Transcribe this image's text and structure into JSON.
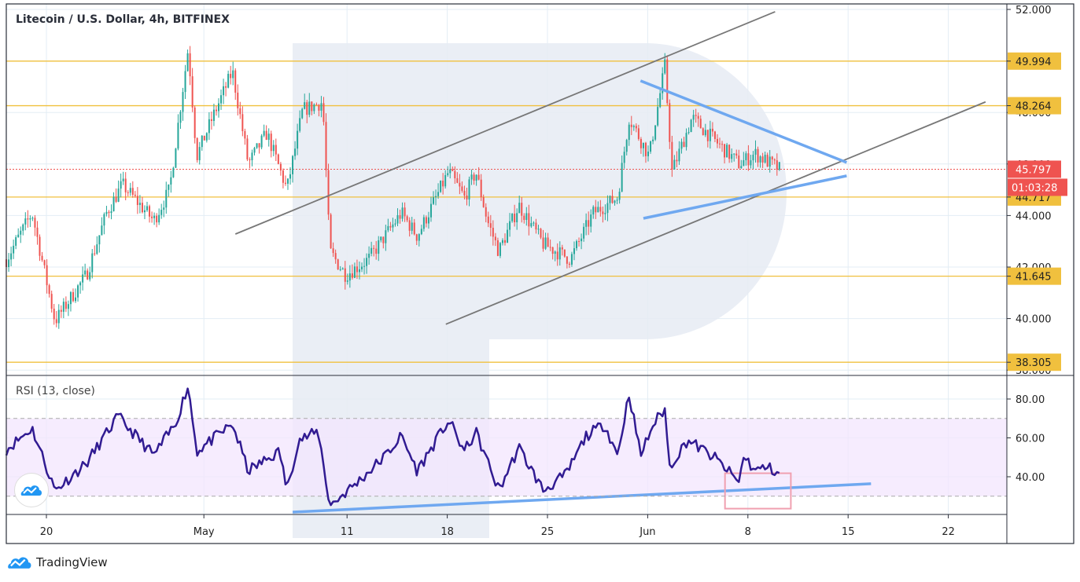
{
  "header": {
    "title": "Litecoin / U.S. Dollar, 4h, BITFINEX"
  },
  "rsi_title": "RSI (13, close)",
  "footer": {
    "brand": "TradingView"
  },
  "colors": {
    "up": "#26a69a",
    "down": "#ef5350",
    "level": "#f0c03e",
    "rsi": "#311b92",
    "trend": "#6fa8f0",
    "channel": "#777777",
    "band": "#f3e5fd",
    "highlight": "#f0a0b0"
  },
  "chart_data": [
    {
      "type": "candlestick",
      "title": "Litecoin / U.S. Dollar, 4h, BITFINEX",
      "x_unit": "days since Apr 20",
      "x_ticks": [
        {
          "day": 0,
          "label": "20"
        },
        {
          "day": 11,
          "label": "May"
        },
        {
          "day": 21,
          "label": "11"
        },
        {
          "day": 28,
          "label": "18"
        },
        {
          "day": 35,
          "label": "25"
        },
        {
          "day": 42,
          "label": "Jun"
        },
        {
          "day": 49,
          "label": "8"
        },
        {
          "day": 56,
          "label": "15"
        },
        {
          "day": 63,
          "label": "22"
        }
      ],
      "y_ticks": [
        "52.000",
        "50.000",
        "48.000",
        "46.000",
        "44.000",
        "42.000",
        "40.000",
        "38.000"
      ],
      "ylim": [
        37.8,
        52.2
      ],
      "close_path": [
        [
          -2.8,
          42.3
        ],
        [
          -1,
          44.1
        ],
        [
          0.6,
          39.9
        ],
        [
          2.8,
          41.7
        ],
        [
          4.2,
          44.1
        ],
        [
          5.3,
          45.2
        ],
        [
          7.5,
          43.8
        ],
        [
          8.6,
          45.0
        ],
        [
          9.9,
          50.5
        ],
        [
          10.5,
          46.3
        ],
        [
          11.6,
          47.8
        ],
        [
          13.0,
          49.6
        ],
        [
          14.1,
          46.0
        ],
        [
          15.4,
          47.2
        ],
        [
          16.8,
          45.0
        ],
        [
          17.9,
          48.1
        ],
        [
          19.3,
          48.4
        ],
        [
          19.8,
          42.6
        ],
        [
          20.9,
          41.7
        ],
        [
          22.5,
          42.3
        ],
        [
          24.8,
          44.1
        ],
        [
          25.9,
          43.2
        ],
        [
          28.1,
          45.7
        ],
        [
          29.2,
          44.7
        ],
        [
          30.0,
          45.7
        ],
        [
          30.8,
          43.8
        ],
        [
          31.6,
          42.6
        ],
        [
          33.0,
          44.4
        ],
        [
          34.7,
          42.9
        ],
        [
          36.6,
          42.3
        ],
        [
          38.2,
          44.1
        ],
        [
          39.9,
          44.7
        ],
        [
          40.7,
          47.8
        ],
        [
          42.1,
          46.3
        ],
        [
          43.2,
          49.8
        ],
        [
          43.7,
          45.7
        ],
        [
          45.1,
          47.8
        ],
        [
          46.7,
          46.9
        ],
        [
          48.4,
          46.0
        ],
        [
          49.5,
          46.4
        ],
        [
          51.2,
          45.8
        ]
      ],
      "levels": [
        "49.994",
        "48.264",
        "44.717",
        "41.645",
        "38.305"
      ],
      "last_price": "45.797",
      "countdown": "01:03:28",
      "channel_lines": [
        [
          [
            13.2,
            43.28
          ],
          [
            50.9,
            51.91
          ]
        ],
        [
          [
            27.9,
            39.78
          ],
          [
            65.6,
            48.41
          ]
        ]
      ],
      "triangle_lines": [
        [
          [
            41.5,
            49.23
          ],
          [
            55.9,
            46.06
          ]
        ],
        [
          [
            41.7,
            43.89
          ],
          [
            55.9,
            45.54
          ]
        ]
      ]
    },
    {
      "type": "line",
      "title": "RSI (13, close)",
      "y_ticks": [
        "80.00",
        "60.00",
        "40.00"
      ],
      "bands": [
        30,
        70
      ],
      "rsi_path": [
        [
          -2.8,
          54
        ],
        [
          -1,
          65
        ],
        [
          0.6,
          33
        ],
        [
          2.8,
          47
        ],
        [
          5,
          71
        ],
        [
          7.5,
          51
        ],
        [
          9,
          67
        ],
        [
          9.9,
          87
        ],
        [
          10.5,
          53
        ],
        [
          13,
          67
        ],
        [
          14.1,
          43
        ],
        [
          16.3,
          53
        ],
        [
          16.8,
          33
        ],
        [
          17.6,
          59
        ],
        [
          19,
          63
        ],
        [
          19.8,
          25
        ],
        [
          22,
          39
        ],
        [
          23.7,
          51
        ],
        [
          24.8,
          61
        ],
        [
          25.9,
          43
        ],
        [
          28.1,
          69
        ],
        [
          29.2,
          53
        ],
        [
          30,
          63
        ],
        [
          31.6,
          33
        ],
        [
          33,
          55
        ],
        [
          34.7,
          33
        ],
        [
          36.3,
          41
        ],
        [
          37.7,
          61
        ],
        [
          39,
          67
        ],
        [
          39.9,
          51
        ],
        [
          40.7,
          83
        ],
        [
          41.5,
          51
        ],
        [
          42.4,
          67
        ],
        [
          43.2,
          75
        ],
        [
          43.5,
          45
        ],
        [
          44.8,
          59
        ],
        [
          46.8,
          49
        ],
        [
          48.4,
          37
        ],
        [
          48.7,
          51
        ],
        [
          49.5,
          43
        ],
        [
          50.3,
          45
        ],
        [
          51.2,
          42
        ]
      ],
      "trend_line": [
        [
          17.2,
          21.8
        ],
        [
          57.6,
          36.4
        ]
      ],
      "highlight_box": {
        "day_from": 47.4,
        "day_to": 52.0,
        "rsi_from": 23.6,
        "rsi_to": 41.8
      }
    }
  ]
}
